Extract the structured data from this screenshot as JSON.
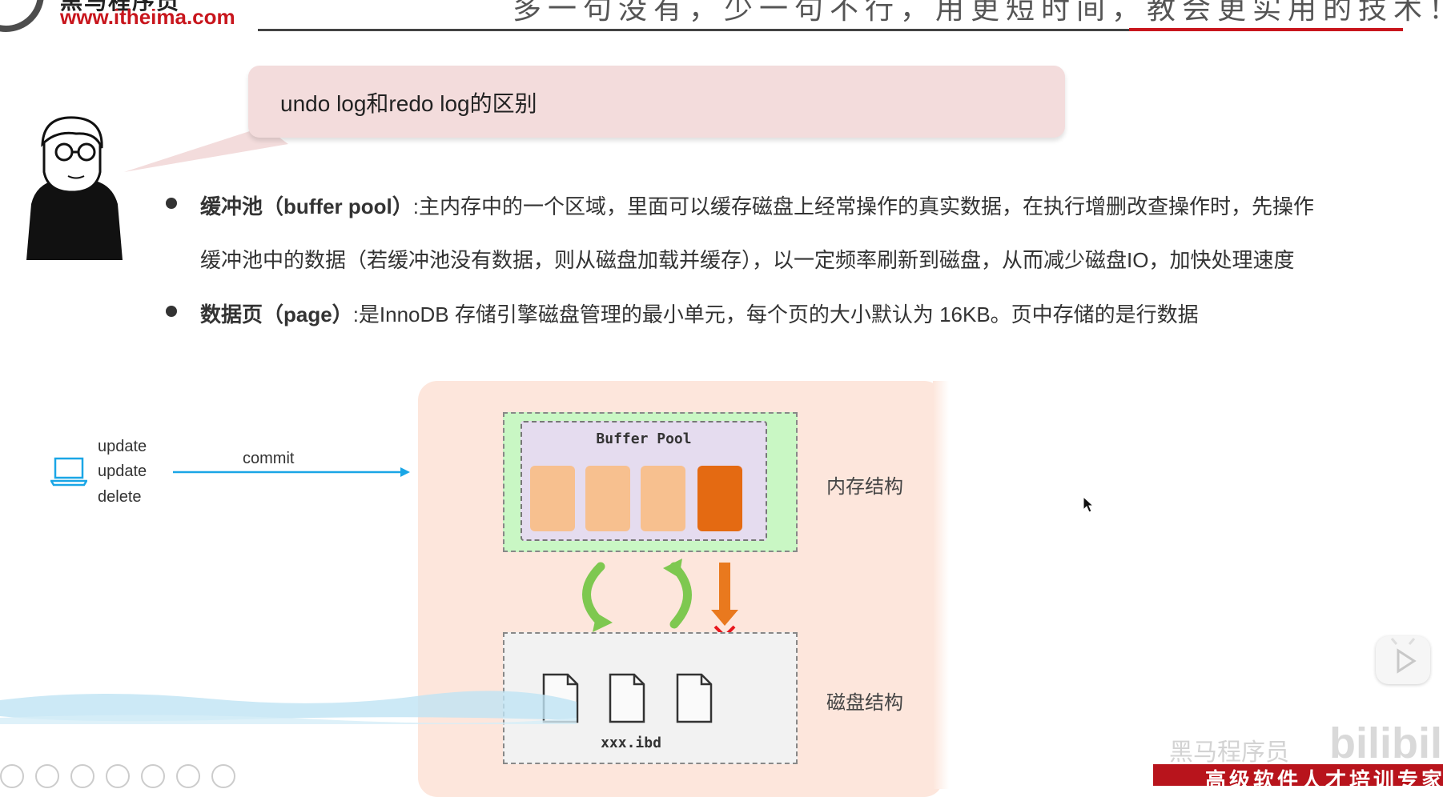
{
  "header": {
    "logo_text": "黑马程序员",
    "logo_url": "www.itheima.com",
    "slogan": "多一句没有，少一句不行，用更短时间，教会更实用的技术！"
  },
  "bubble": {
    "title": "undo log和redo log的区别"
  },
  "bullets": [
    {
      "term": "缓冲池（buffer pool）",
      "text_line1": ":主内存中的一个区域，里面可以缓存磁盘上经常操作的真实数据，在执行增删改查操作时，先操作",
      "text_line2": "缓冲池中的数据（若缓冲池没有数据，则从磁盘加载并缓存），以一定频率刷新到磁盘，从而减少磁盘IO，加快处理速度"
    },
    {
      "term": "数据页（page）",
      "text_line1": ":是InnoDB 存储引擎磁盘管理的最小单元，每个页的大小默认为 16KB。页中存储的是行数据"
    }
  ],
  "diagram": {
    "operations": [
      "update",
      "update",
      "delete"
    ],
    "commit_label": "commit",
    "buffer_pool_label": "Buffer Pool",
    "memory_label": "内存结构",
    "disk_label": "磁盘结构",
    "file_label": "xxx.ibd",
    "colors": {
      "page_light": "#f7c08f",
      "page_dark": "#e46a12",
      "arrow_green": "#7ec850",
      "arrow_orange": "#e9791e",
      "cross_red": "#e8161d",
      "commit_arrow": "#1aa6e6"
    }
  },
  "watermark": {
    "text1": "黑马程序员",
    "text2": "bilibili"
  },
  "banner": {
    "text": "高级软件人才培训专家"
  },
  "icons": {
    "laptop": "laptop-icon",
    "file": "file-icon",
    "play": "play-icon",
    "cursor": "mouse-cursor-icon"
  }
}
